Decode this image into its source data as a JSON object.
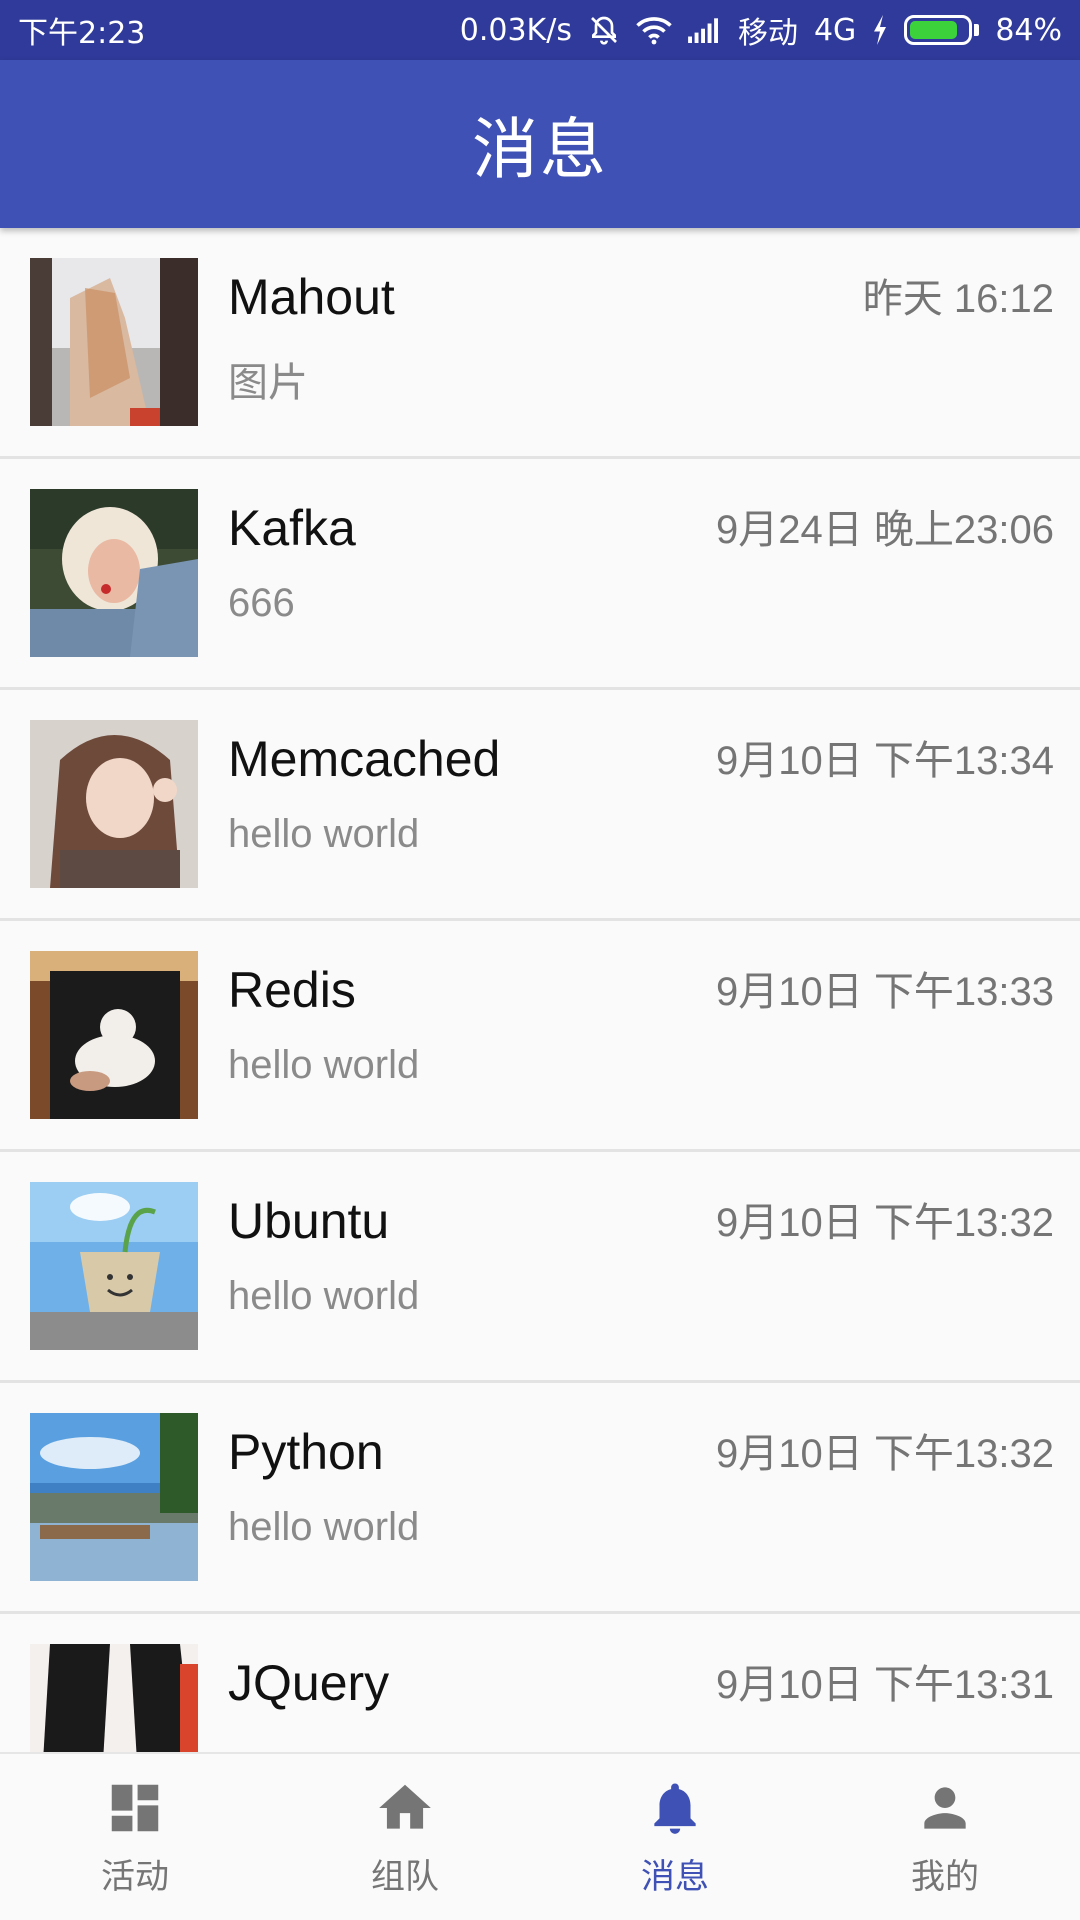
{
  "status_bar": {
    "time": "下午2:23",
    "net_speed": "0.03K/s",
    "carrier": "移动",
    "network": "4G",
    "battery_percent": "84%",
    "battery_level": 0.84,
    "icons": [
      "alarm-off-icon",
      "wifi-icon",
      "signal-icon",
      "charging-icon",
      "battery-icon"
    ]
  },
  "app_bar": {
    "title": "消息"
  },
  "messages": [
    {
      "name": "Mahout",
      "preview": "图片",
      "time": "昨天 16:12"
    },
    {
      "name": "Kafka",
      "preview": "666",
      "time": "9月24日 晚上23:06"
    },
    {
      "name": "Memcached",
      "preview": "hello world",
      "time": "9月10日 下午13:34"
    },
    {
      "name": "Redis",
      "preview": "hello world",
      "time": "9月10日 下午13:33"
    },
    {
      "name": "Ubuntu",
      "preview": "hello world",
      "time": "9月10日 下午13:32"
    },
    {
      "name": "Python",
      "preview": "hello world",
      "time": "9月10日 下午13:32"
    },
    {
      "name": "JQuery",
      "preview": "",
      "time": "9月10日 下午13:31"
    }
  ],
  "bottom_nav": {
    "items": [
      {
        "label": "活动",
        "icon": "dashboard-icon"
      },
      {
        "label": "组队",
        "icon": "home-icon"
      },
      {
        "label": "消息",
        "icon": "bell-icon"
      },
      {
        "label": "我的",
        "icon": "person-icon"
      }
    ],
    "active": "消息"
  },
  "colors": {
    "status_bar": "#2f3a9a",
    "app_bar": "#3f51b5",
    "accent": "#3f51b5",
    "nav_inactive": "#757575",
    "battery_fill": "#3cd23c"
  }
}
